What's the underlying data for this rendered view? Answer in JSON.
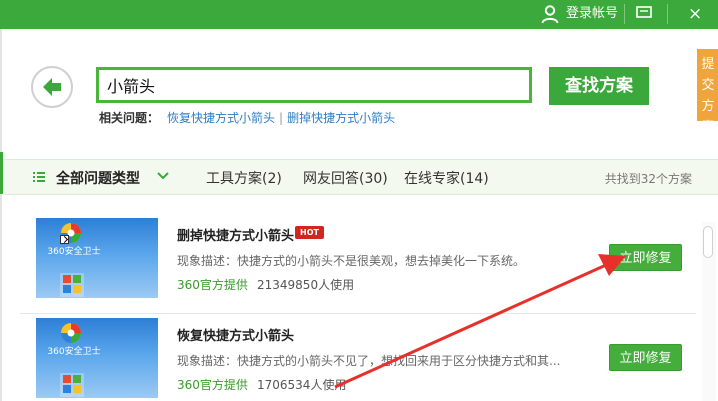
{
  "titlebar": {
    "login_label": "登录帐号",
    "close_glyph": "×",
    "icons": [
      "user-icon",
      "feedback-icon",
      "close-icon"
    ]
  },
  "search": {
    "query": "小箭头",
    "button_label": "查找方案"
  },
  "related": {
    "label": "相关问题：",
    "links": [
      "恢复快捷方式小箭头",
      "删掉快捷方式小箭头"
    ],
    "separator": "|"
  },
  "submit_tab": {
    "label": "提交方案"
  },
  "filter": {
    "all_types": "全部问题类型",
    "tabs": [
      "工具方案(2)",
      "网友回答(30)",
      "在线专家(14)"
    ],
    "count": "共找到32个方案"
  },
  "results": [
    {
      "title": "删掉快捷方式小箭头",
      "badge": "HOT",
      "desc": "现象描述：快捷方式的小箭头不是很美观，想去掉美化一下系统。",
      "source": "360官方提供",
      "users": "21349850人使用",
      "button": "立即修复",
      "thumb_caption": "360安全卫士"
    },
    {
      "title": "恢复快捷方式小箭头",
      "desc": "现象描述：快捷方式的小箭头不见了，想找回来用于区分快捷方式和其...",
      "source": "360官方提供",
      "users": "1706534人使用",
      "button": "立即修复",
      "thumb_caption": "360安全卫士"
    }
  ],
  "colors": {
    "brand_green": "#3ca93c",
    "link_blue": "#2e7ec4",
    "hot_red": "#d0261f",
    "submit_orange": "#f0a53c",
    "annotation_red": "#e8302a"
  }
}
